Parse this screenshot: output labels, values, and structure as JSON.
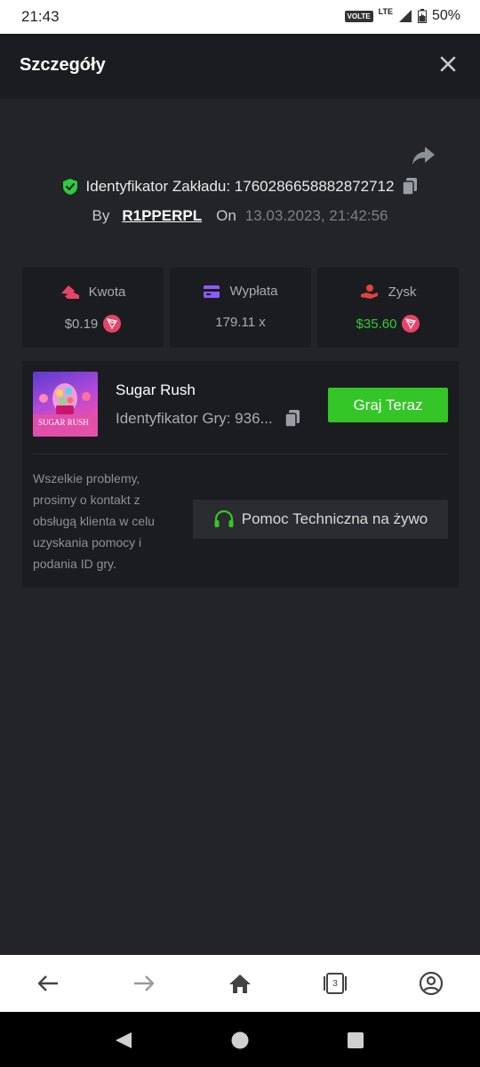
{
  "status_bar": {
    "time": "21:43",
    "volte": "VOLTE",
    "network": "LTE",
    "battery": "50%"
  },
  "header": {
    "title": "Szczegóły"
  },
  "bet": {
    "id_label": "Identyfikator Zakładu: 1760286658882872712",
    "by_label": "By",
    "username": "R1PPERPL",
    "on_label": "On",
    "date": "13.03.2023, 21:42:56"
  },
  "stats": [
    {
      "title": "Kwota",
      "value": "$0.19",
      "icon": "wallet-icon"
    },
    {
      "title": "Wypłata",
      "value": "179.11 x",
      "icon": "card-icon"
    },
    {
      "title": "Zysk",
      "value": "$35.60",
      "icon": "profit-hand-icon"
    }
  ],
  "game": {
    "name": "Sugar Rush",
    "id_label": "Identyfikator Gry: 936...",
    "play_label": "Graj Teraz",
    "thumb_text": "SUGAR RUSH",
    "help_text": "Wszelkie problemy, prosimy o kontakt z obsługą klienta w celu uzyskania pomocy i podania ID gry.",
    "support_label": "Pomoc Techniczna na żywo"
  },
  "browser": {
    "tab_count": "3"
  },
  "colors": {
    "background": "#232428",
    "panel": "#1b1c20",
    "accent_green": "#34c626",
    "profit_green": "#33cc33",
    "trx_red": "#e8436a",
    "wallet_pink": "#e8436a",
    "card_purple": "#8b5cf6",
    "hand_red": "#e0443a",
    "shield_green": "#2ecc40"
  }
}
